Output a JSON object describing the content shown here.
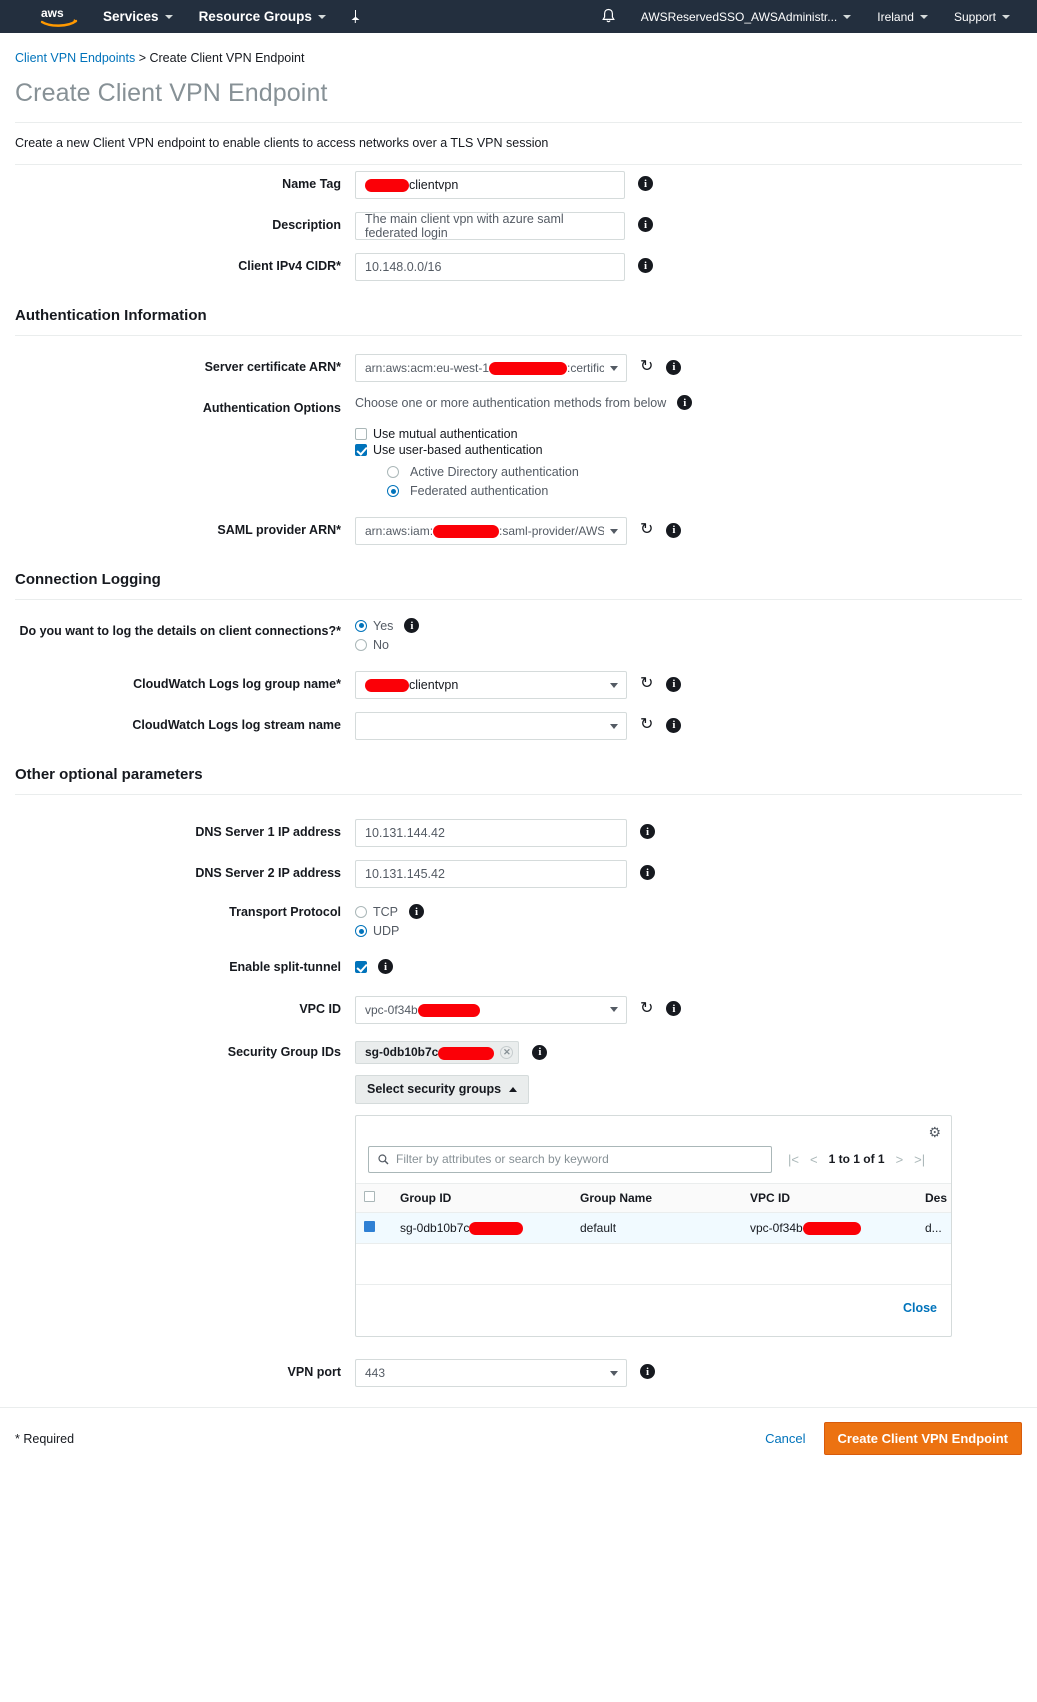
{
  "topnav": {
    "logo": "aws-logo",
    "services_label": "Services",
    "resource_groups_label": "Resource Groups",
    "pin_icon": "pin-icon",
    "bell_icon": "bell-icon",
    "account_label": "AWSReservedSSO_AWSAdministr...",
    "region_label": "Ireland",
    "support_label": "Support"
  },
  "breadcrumb": {
    "link": "Client VPN Endpoints",
    "separator": ">",
    "current": "Create Client VPN Endpoint"
  },
  "page": {
    "title": "Create Client VPN Endpoint",
    "subtitle": "Create a new Client VPN endpoint to enable clients to access networks over a TLS VPN session"
  },
  "form": {
    "name_tag": {
      "label": "Name Tag",
      "value": "clientvpn",
      "redacted": true
    },
    "description": {
      "label": "Description",
      "value": "The main client vpn with azure saml federated login"
    },
    "client_cidr": {
      "label": "Client IPv4 CIDR*",
      "value": "10.148.0.0/16"
    }
  },
  "auth_section": {
    "heading": "Authentication Information",
    "server_cert": {
      "label": "Server certificate ARN*",
      "prefix": "arn:aws:acm:eu-west-1",
      "suffix": ":certificate."
    },
    "auth_options": {
      "label": "Authentication Options",
      "helper": "Choose one or more authentication methods from below",
      "mutual": {
        "label": "Use mutual authentication",
        "checked": false
      },
      "user_based": {
        "label": "Use user-based authentication",
        "checked": true
      },
      "active_directory": {
        "label": "Active Directory authentication",
        "selected": false
      },
      "federated": {
        "label": "Federated authentication",
        "selected": true
      }
    },
    "saml_provider": {
      "label": "SAML provider ARN*",
      "prefix": "arn:aws:iam:",
      "suffix": ":saml-provider/AWS-"
    }
  },
  "logging_section": {
    "heading": "Connection Logging",
    "question": {
      "label": "Do you want to log the details on client connections?*",
      "yes": "Yes",
      "no": "No",
      "value": "Yes"
    },
    "log_group": {
      "label": "CloudWatch Logs log group name*",
      "value": "clientvpn",
      "redacted": true
    },
    "log_stream": {
      "label": "CloudWatch Logs log stream name",
      "value": ""
    }
  },
  "optional_section": {
    "heading": "Other optional parameters",
    "dns1": {
      "label": "DNS Server 1 IP address",
      "value": "10.131.144.42"
    },
    "dns2": {
      "label": "DNS Server 2 IP address",
      "value": "10.131.145.42"
    },
    "transport": {
      "label": "Transport Protocol",
      "tcp": "TCP",
      "udp": "UDP",
      "value": "UDP"
    },
    "split_tunnel": {
      "label": "Enable split-tunnel",
      "checked": true
    },
    "vpc_id": {
      "label": "VPC ID",
      "value": "vpc-0f34b"
    },
    "security_groups": {
      "label": "Security Group IDs",
      "pill_value": "sg-0db10b7c",
      "remove_icon": "close-icon",
      "select_button": "Select security groups"
    },
    "vpn_port": {
      "label": "VPN port",
      "value": "443"
    }
  },
  "sg_panel": {
    "gear_icon": "gear-icon",
    "search_icon": "search-icon",
    "search_placeholder": "Filter by attributes or search by keyword",
    "pager": {
      "first": "|<",
      "prev": "<",
      "count": "1 to 1 of 1",
      "next": ">",
      "last": ">|"
    },
    "columns": [
      "Group ID",
      "Group Name",
      "VPC ID",
      "Des"
    ],
    "rows": [
      {
        "selected": true,
        "group_id": "sg-0db10b7c",
        "group_name": "default",
        "vpc_id": "vpc-0f34b",
        "description": "d..."
      }
    ],
    "close_label": "Close"
  },
  "footer": {
    "required_note": "* Required",
    "cancel_label": "Cancel",
    "create_label": "Create Client VPN Endpoint"
  },
  "colors": {
    "nav_bg": "#232f3e",
    "link": "#0073bb",
    "primary_button": "#ec7211",
    "accent_blue": "#0073bb",
    "redaction": "#fb0007"
  }
}
